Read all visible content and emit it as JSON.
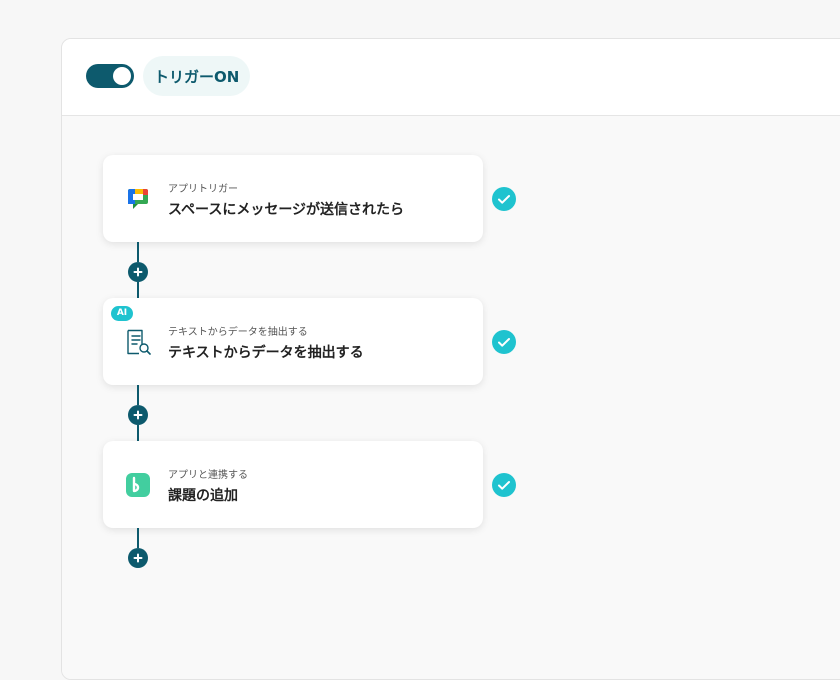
{
  "header": {
    "trigger_label": "トリガーON",
    "trigger_on": true
  },
  "flow": {
    "steps": [
      {
        "subtitle": "アプリトリガー",
        "title": "スペースにメッセージが送信されたら",
        "icon": "google-chat-icon",
        "ai": false,
        "completed": true
      },
      {
        "subtitle": "テキストからデータを抽出する",
        "title": "テキストからデータを抽出する",
        "icon": "document-search-icon",
        "ai": true,
        "ai_label": "AI",
        "completed": true
      },
      {
        "subtitle": "アプリと連携する",
        "title": "課題の追加",
        "icon": "backlog-icon",
        "ai": false,
        "completed": true
      }
    ]
  },
  "colors": {
    "primary": "#0d5a6d",
    "accent": "#1fc3cf",
    "pill_bg": "#eef7f7"
  }
}
